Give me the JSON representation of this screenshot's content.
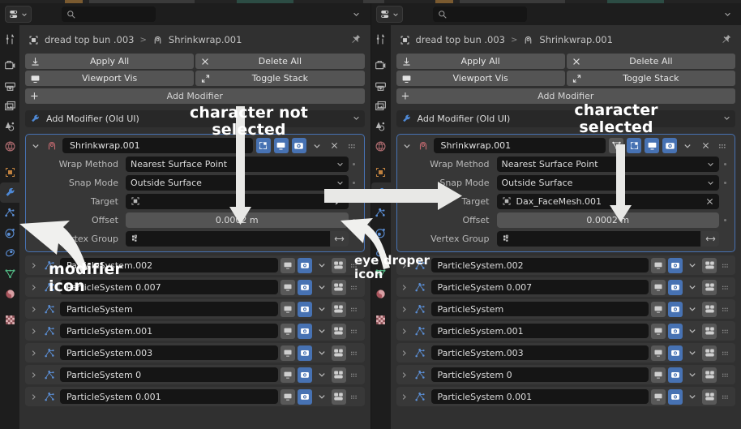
{
  "window": {
    "app": "Blender Properties Editor",
    "comparison": "side-by-side shrinkwrap modifier target"
  },
  "colors": {
    "accent_blue": "#4772b3",
    "panel_bg": "#303030",
    "card_bg": "#373737",
    "field_bg": "#151515",
    "button_bg": "#545454",
    "header_bg": "#1d1d1d",
    "annotation": "#ffffff"
  },
  "panels": [
    {
      "id": "left",
      "state_label": "character not selected",
      "header": {
        "editor_type_icon": "properties-editor-icon",
        "editor_chevron_icon": "chevron-down-icon",
        "search_icon": "search-icon",
        "search_value": "",
        "search_placeholder": "",
        "options_chevron_icon": "chevron-down-icon"
      },
      "breadcrumb": {
        "object_icon": "object-data-icon",
        "object": "dread top bun .003",
        "separator": ">",
        "modifier_icon": "shrinkwrap-modifier-icon",
        "modifier": "Shrinkwrap.001",
        "pin_icon": "pin-icon"
      },
      "operator_buttons": [
        {
          "label": "Apply All",
          "icon": "download-icon"
        },
        {
          "label": "Delete All",
          "icon": "close-x-icon"
        },
        {
          "label": "Viewport Vis",
          "icon": "monitor-icon"
        },
        {
          "label": "Toggle Stack",
          "icon": "expand-arrows-icon"
        }
      ],
      "add_modifier": {
        "label": "Add Modifier",
        "icon": "plus-icon"
      },
      "add_modifier_old": {
        "label": "Add Modifier (Old UI)",
        "icon": "wrench-icon",
        "chevron": "chevron-down-icon"
      },
      "modifier": {
        "expand_icon": "chevron-down-icon",
        "type_icon": "shrinkwrap-modifier-icon",
        "name": "Shrinkwrap.001",
        "toggles": [
          {
            "name": "edit-mode-display-toggle",
            "icon": "edit-mode-icon",
            "state": "hidden"
          },
          {
            "name": "on-cage-toggle",
            "icon": "on-cage-icon",
            "state": "on"
          },
          {
            "name": "realtime-display-toggle",
            "icon": "monitor-icon",
            "state": "on"
          },
          {
            "name": "render-display-toggle",
            "icon": "camera-icon",
            "state": "on"
          }
        ],
        "extras_chevron": "chevron-down-icon",
        "close_icon": "close-x-icon",
        "grip_icon": "drag-grip-icon",
        "properties": [
          {
            "label": "Wrap Method",
            "value": "Nearest Surface Point",
            "kind": "enum",
            "decorator": true
          },
          {
            "label": "Snap Mode",
            "value": "Outside Surface",
            "kind": "enum",
            "decorator": true
          },
          {
            "label": "Target",
            "value": "",
            "kind": "object-pointer",
            "icon": "object-data-icon",
            "trailing_icon": "eyedropper-icon"
          },
          {
            "label": "Offset",
            "value": "0.0002 m",
            "kind": "value",
            "decorator": true
          },
          {
            "label": "Vertex Group",
            "value": "",
            "kind": "vertex-group",
            "icon": "vertex-group-icon",
            "trailing_icon": "invert-arrows-icon"
          }
        ]
      },
      "particle_systems": [
        {
          "name": "ParticleSystem.002",
          "realtime": "off",
          "render": "on"
        },
        {
          "name": "ParticleSystem 0.007",
          "realtime": "off",
          "render": "on"
        },
        {
          "name": "ParticleSystem",
          "realtime": "off",
          "render": "on"
        },
        {
          "name": "ParticleSystem.001",
          "realtime": "off",
          "render": "on"
        },
        {
          "name": "ParticleSystem.003",
          "realtime": "off",
          "render": "on"
        },
        {
          "name": "ParticleSystem 0",
          "realtime": "off",
          "render": "on"
        },
        {
          "name": "ParticleSystem 0.001",
          "realtime": "off",
          "render": "on"
        }
      ]
    },
    {
      "id": "right",
      "state_label": "character selected",
      "header": {
        "editor_type_icon": "properties-editor-icon",
        "editor_chevron_icon": "chevron-down-icon",
        "search_icon": "search-icon",
        "search_value": "",
        "search_placeholder": "",
        "options_chevron_icon": "chevron-down-icon"
      },
      "breadcrumb": {
        "object_icon": "object-data-icon",
        "object": "dread top bun .003",
        "separator": ">",
        "modifier_icon": "shrinkwrap-modifier-icon",
        "modifier": "Shrinkwrap.001",
        "pin_icon": "pin-icon"
      },
      "operator_buttons": [
        {
          "label": "Apply All",
          "icon": "download-icon"
        },
        {
          "label": "Delete All",
          "icon": "close-x-icon"
        },
        {
          "label": "Viewport Vis",
          "icon": "monitor-icon"
        },
        {
          "label": "Toggle Stack",
          "icon": "expand-arrows-icon"
        }
      ],
      "add_modifier": {
        "label": "Add Modifier",
        "icon": "plus-icon"
      },
      "add_modifier_old": {
        "label": "Add Modifier (Old UI)",
        "icon": "wrench-icon",
        "chevron": "chevron-down-icon"
      },
      "modifier": {
        "expand_icon": "chevron-down-icon",
        "type_icon": "shrinkwrap-modifier-icon",
        "name": "Shrinkwrap.001",
        "toggles": [
          {
            "name": "edit-mode-display-toggle",
            "icon": "edit-mode-icon",
            "state": "off"
          },
          {
            "name": "on-cage-toggle",
            "icon": "on-cage-icon",
            "state": "on"
          },
          {
            "name": "realtime-display-toggle",
            "icon": "monitor-icon",
            "state": "on"
          },
          {
            "name": "render-display-toggle",
            "icon": "camera-icon",
            "state": "on"
          }
        ],
        "extras_chevron": "chevron-down-icon",
        "close_icon": "close-x-icon",
        "grip_icon": "drag-grip-icon",
        "properties": [
          {
            "label": "Wrap Method",
            "value": "Nearest Surface Point",
            "kind": "enum",
            "decorator": true
          },
          {
            "label": "Snap Mode",
            "value": "Outside Surface",
            "kind": "enum",
            "decorator": true
          },
          {
            "label": "Target",
            "value": "Dax_FaceMesh.001",
            "kind": "object-pointer",
            "icon": "object-data-icon",
            "trailing_icon": "close-x-icon"
          },
          {
            "label": "Offset",
            "value": "0.0002 m",
            "kind": "value",
            "decorator": true
          },
          {
            "label": "Vertex Group",
            "value": "",
            "kind": "vertex-group",
            "icon": "vertex-group-icon",
            "trailing_icon": "invert-arrows-icon"
          }
        ]
      },
      "particle_systems": [
        {
          "name": "ParticleSystem.002",
          "realtime": "off",
          "render": "on"
        },
        {
          "name": "ParticleSystem 0.007",
          "realtime": "off",
          "render": "on"
        },
        {
          "name": "ParticleSystem",
          "realtime": "off",
          "render": "on"
        },
        {
          "name": "ParticleSystem.001",
          "realtime": "off",
          "render": "on"
        },
        {
          "name": "ParticleSystem.003",
          "realtime": "off",
          "render": "on"
        },
        {
          "name": "ParticleSystem 0",
          "realtime": "off",
          "render": "on"
        },
        {
          "name": "ParticleSystem 0.001",
          "realtime": "off",
          "render": "on"
        }
      ]
    }
  ],
  "property_tabs": [
    {
      "name": "tool-tab",
      "icon": "tool-icon",
      "active": false
    },
    {
      "name": "render-tab",
      "icon": "render-camera-icon",
      "active": false
    },
    {
      "name": "output-tab",
      "icon": "printer-icon",
      "active": false
    },
    {
      "name": "view-layer-tab",
      "icon": "images-icon",
      "active": false
    },
    {
      "name": "scene-tab",
      "icon": "scene-cone-icon",
      "active": false
    },
    {
      "name": "world-tab",
      "icon": "world-globe-icon",
      "active": false
    },
    {
      "name": "object-tab",
      "icon": "object-square-icon",
      "active": false
    },
    {
      "name": "modifier-tab",
      "icon": "wrench-icon",
      "active": true
    },
    {
      "name": "particles-tab",
      "icon": "particles-icon",
      "active": false
    },
    {
      "name": "physics-tab",
      "icon": "physics-orbit-icon",
      "active": false
    },
    {
      "name": "constraints-tab",
      "icon": "constraints-icon",
      "active": false
    },
    {
      "name": "object-data-tab",
      "icon": "mesh-data-triangle-icon",
      "active": false
    },
    {
      "name": "material-tab",
      "icon": "material-sphere-icon",
      "active": false
    },
    {
      "name": "texture-tab",
      "icon": "texture-checker-icon",
      "active": false
    }
  ],
  "annotations": [
    {
      "id": "character-not-selected",
      "text": "character not\nselected",
      "line1": "character not",
      "line2": "selected"
    },
    {
      "id": "character-selected",
      "text": "character\nselected",
      "line1": "character",
      "line2": "selected"
    },
    {
      "id": "modifier-icon-label",
      "line1": "modifier",
      "line2": "icon"
    },
    {
      "id": "eye-droper-icon-label",
      "line1": "eye droper",
      "line2": "icon"
    }
  ]
}
